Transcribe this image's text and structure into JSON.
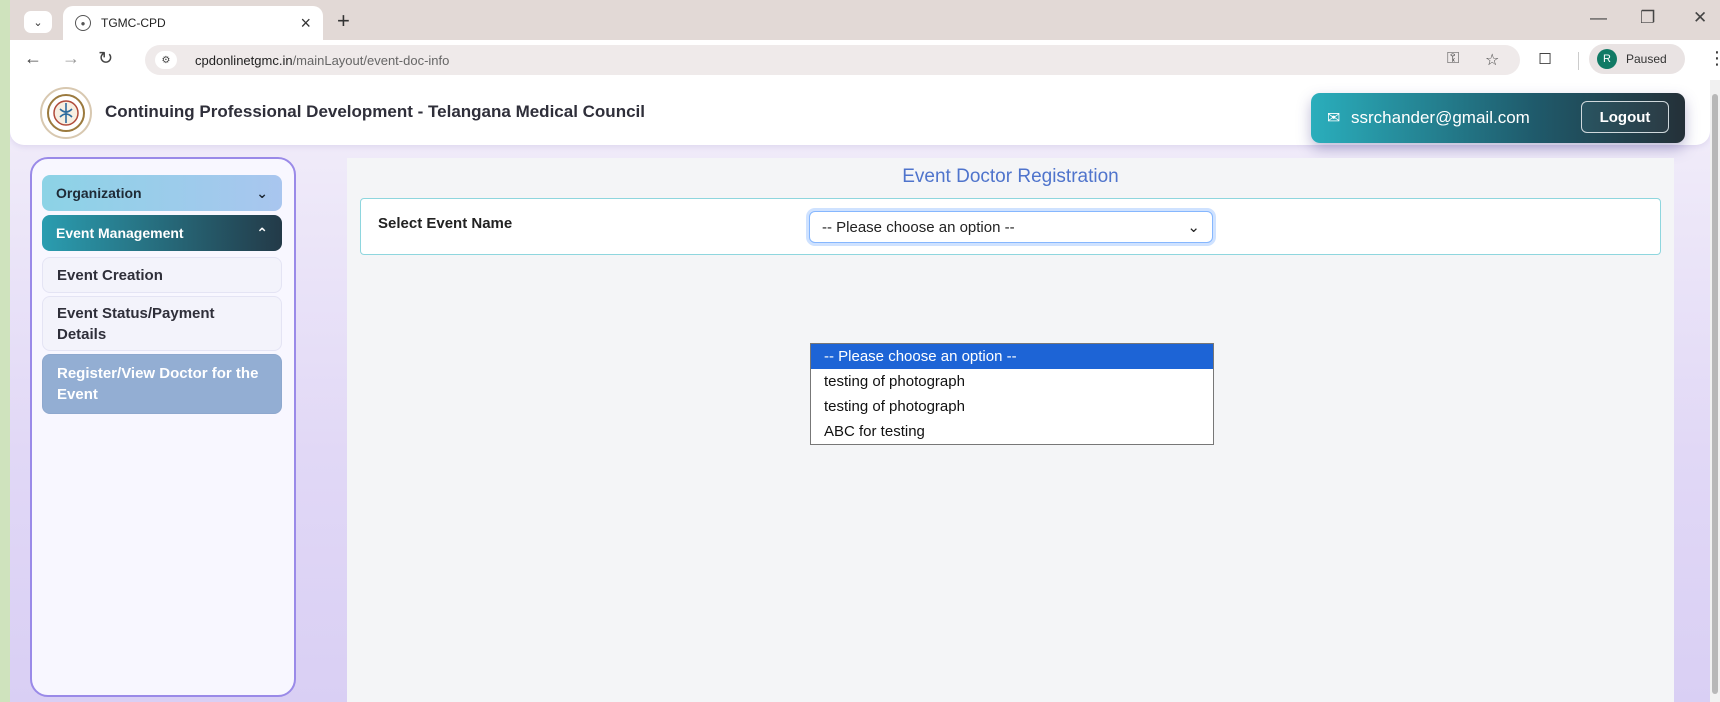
{
  "browser": {
    "tab_title": "TGMC-CPD",
    "url_host": "cpdonlinetgmc.in",
    "url_path": "/mainLayout/event-doc-info",
    "profile_initial": "R",
    "profile_status": "Paused"
  },
  "header": {
    "title": "Continuing Professional Development - Telangana Medical Council",
    "email": "ssrchander@gmail.com",
    "logout_label": "Logout"
  },
  "sidebar": {
    "groups": [
      {
        "label": "Organization",
        "expanded": false
      },
      {
        "label": "Event Management",
        "expanded": true
      }
    ],
    "items": [
      {
        "label": "Event Creation"
      },
      {
        "label": "Event Status/Payment Details"
      },
      {
        "label": "Register/View Doctor for the Event",
        "active": true
      }
    ]
  },
  "main": {
    "title": "Event Doctor Registration",
    "field_label": "Select Event Name",
    "select_value": "-- Please choose an option --",
    "options": [
      {
        "label": "-- Please choose an option --",
        "selected": true
      },
      {
        "label": "testing of photograph"
      },
      {
        "label": "testing of photograph"
      },
      {
        "label": "ABC for testing"
      }
    ]
  },
  "colors": {
    "accent": "#4f74cc",
    "selected_option": "#1d64d6",
    "active_menu": "#93aed3"
  }
}
